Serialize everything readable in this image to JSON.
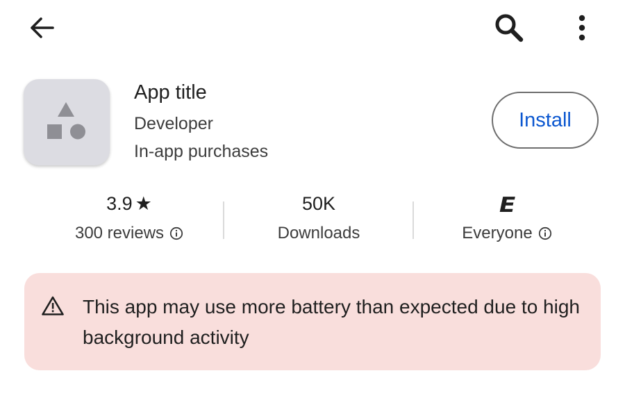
{
  "topbar": {
    "back_icon": "arrow-back-icon",
    "search_icon": "search-icon",
    "more_icon": "more-vert-icon"
  },
  "app": {
    "icon": "app-placeholder-shapes-icon",
    "title": "App title",
    "developer": "Developer",
    "purchases": "In-app purchases",
    "install_label": "Install"
  },
  "stats": {
    "rating": {
      "value": "3.9",
      "star": "★",
      "reviews": "300 reviews"
    },
    "downloads": {
      "value": "50K",
      "label": "Downloads"
    },
    "content_rating": {
      "badge": "E",
      "label": "Everyone"
    }
  },
  "warning": {
    "icon": "warning-triangle-icon",
    "text": "This app may use more battery than expected due to high background activity"
  },
  "colors": {
    "accent": "#0b57d0",
    "warning_bg": "#f9dedc",
    "icon_bg": "#dcdce2"
  }
}
